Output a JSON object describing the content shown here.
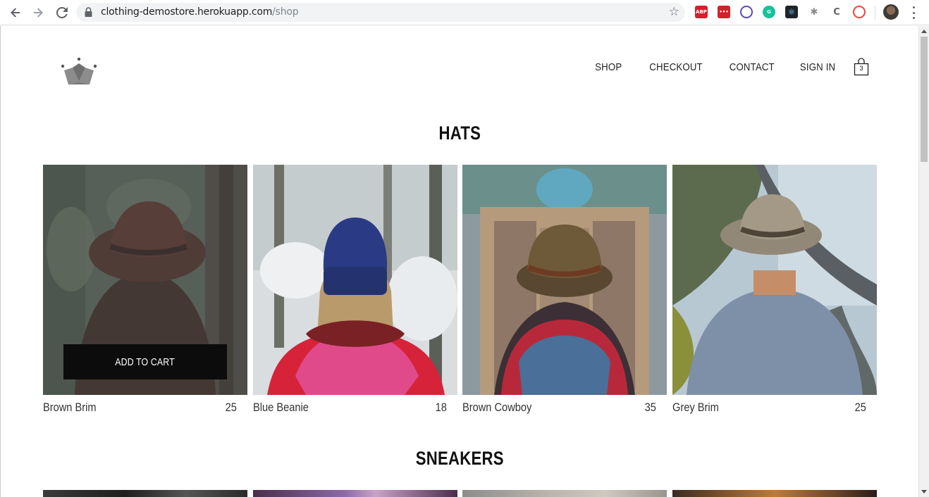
{
  "browser": {
    "url_host": "clothing-demostore.herokuapp.com",
    "url_path": "/shop",
    "extensions": [
      {
        "name": "adblock-plus-icon",
        "label": "ABP",
        "color": "#d3202a"
      },
      {
        "name": "ellipsis-ext-icon",
        "label": "•••",
        "color": "#d3202a"
      },
      {
        "name": "block-ext-icon",
        "label": "",
        "color": "#5b4bb7"
      },
      {
        "name": "grammarly-icon",
        "label": "G",
        "color": "#15c39a"
      },
      {
        "name": "react-devtools-icon",
        "label": "",
        "color": "#20232a"
      },
      {
        "name": "bug-ext-icon",
        "label": "",
        "color": "#8a8a8a"
      },
      {
        "name": "c-ext-icon",
        "label": "C",
        "color": "#5f6368"
      },
      {
        "name": "ring-ext-icon",
        "label": "",
        "color": "#e8453c"
      }
    ]
  },
  "header": {
    "nav": [
      "SHOP",
      "CHECKOUT",
      "CONTACT",
      "SIGN IN"
    ],
    "cart_count": "3"
  },
  "sections": [
    {
      "title": "HATS",
      "items": [
        {
          "name": "Brown Brim",
          "price": "25",
          "hovered": true
        },
        {
          "name": "Blue Beanie",
          "price": "18"
        },
        {
          "name": "Brown Cowboy",
          "price": "35"
        },
        {
          "name": "Grey Brim",
          "price": "25"
        }
      ]
    },
    {
      "title": "SNEAKERS",
      "items": []
    }
  ],
  "add_to_cart_label": "ADD TO CART",
  "colors": {
    "accent_dark": "#0c0c0c",
    "text": "#222222"
  }
}
